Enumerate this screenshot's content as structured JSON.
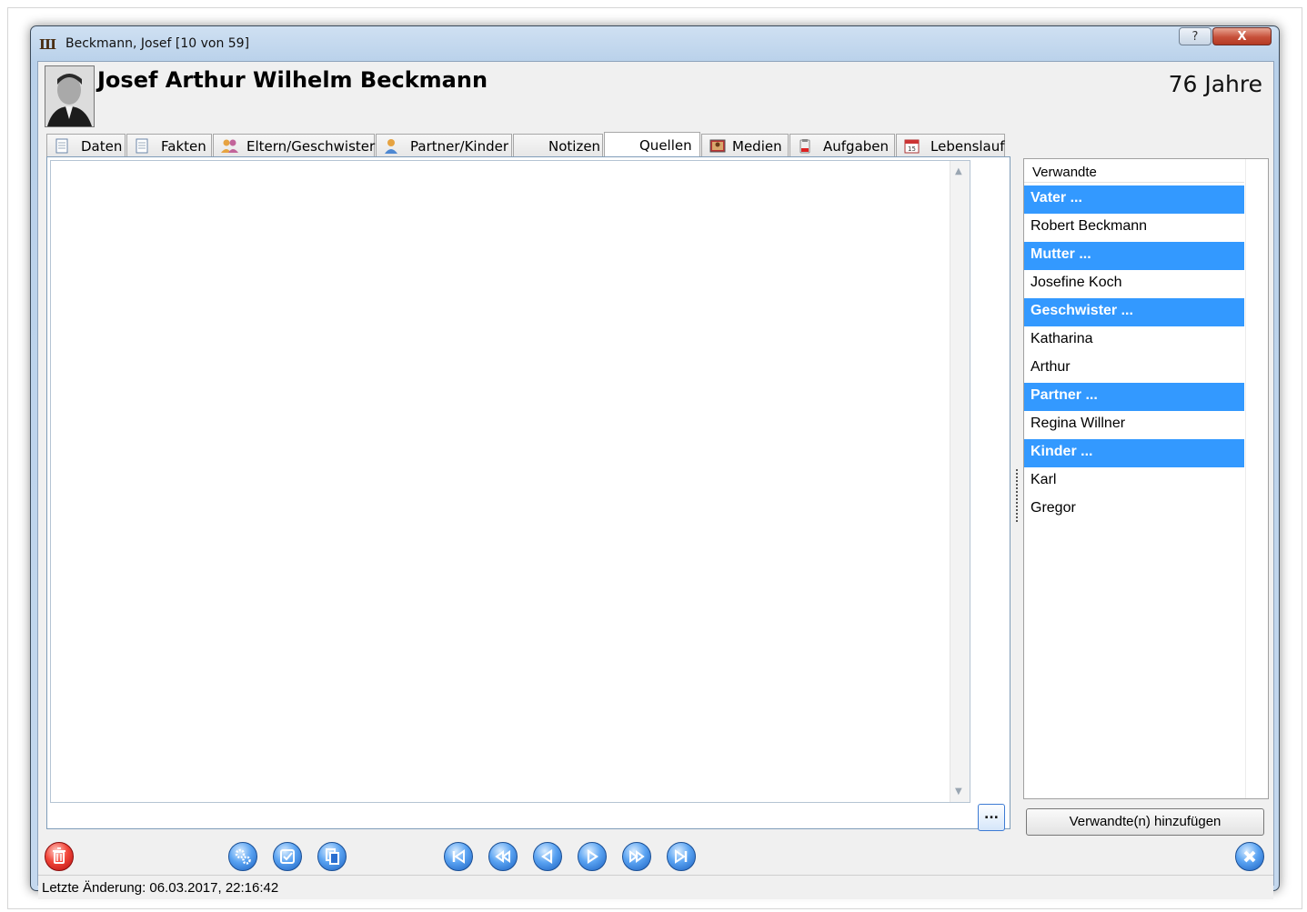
{
  "window": {
    "title": "Beckmann, Josef [10 von 59]",
    "help_label": "?",
    "close_label": "X"
  },
  "person": {
    "full_name": "Josef Arthur Wilhelm Beckmann",
    "age": "76 Jahre"
  },
  "tabs": [
    {
      "label": "Daten",
      "icon": "document-icon",
      "active": false
    },
    {
      "label": "Fakten",
      "icon": "document-icon",
      "active": false
    },
    {
      "label": "Eltern/Geschwister",
      "icon": "people-icon",
      "active": false
    },
    {
      "label": "Partner/Kinder",
      "icon": "person-icon",
      "active": false
    },
    {
      "label": "Notizen",
      "icon": "",
      "active": false
    },
    {
      "label": "Quellen",
      "icon": "",
      "active": true
    },
    {
      "label": "Medien",
      "icon": "picture-icon",
      "active": false
    },
    {
      "label": "Aufgaben",
      "icon": "clipboard-icon",
      "active": false
    },
    {
      "label": "Lebenslauf",
      "icon": "calendar-icon",
      "active": false
    }
  ],
  "calendar_icon_text": "15",
  "more_button_label": "...",
  "relatives": {
    "header": "Verwandte",
    "rows": [
      {
        "label": "Vater ...",
        "group": true
      },
      {
        "label": "Robert Beckmann",
        "group": false
      },
      {
        "label": "Mutter ...",
        "group": true
      },
      {
        "label": "Josefine Koch",
        "group": false
      },
      {
        "label": "Geschwister ...",
        "group": true
      },
      {
        "label": "Katharina",
        "group": false
      },
      {
        "label": "Arthur",
        "group": false
      },
      {
        "label": "Partner ...",
        "group": true
      },
      {
        "label": "Regina Willner",
        "group": false
      },
      {
        "label": "Kinder ...",
        "group": true
      },
      {
        "label": "Karl",
        "group": false
      },
      {
        "label": "Gregor",
        "group": false
      }
    ],
    "add_button": "Verwandte(n) hinzufügen"
  },
  "toolbar": {
    "buttons": [
      {
        "name": "delete-button",
        "icon": "trash-icon",
        "color": "red"
      },
      {
        "name": "settings-button",
        "icon": "gears-icon",
        "color": "blue"
      },
      {
        "name": "check-button",
        "icon": "checkbox-icon",
        "color": "blue"
      },
      {
        "name": "copy-button",
        "icon": "copy-icon",
        "color": "blue"
      },
      {
        "name": "first-record-button",
        "icon": "skip-first-icon",
        "color": "blue"
      },
      {
        "name": "rewind-button",
        "icon": "rewind-icon",
        "color": "blue"
      },
      {
        "name": "previous-button",
        "icon": "previous-icon",
        "color": "blue"
      },
      {
        "name": "next-button",
        "icon": "next-icon",
        "color": "blue"
      },
      {
        "name": "fast-forward-button",
        "icon": "fast-forward-icon",
        "color": "blue"
      },
      {
        "name": "last-record-button",
        "icon": "skip-last-icon",
        "color": "blue"
      },
      {
        "name": "close-form-button",
        "icon": "close-icon",
        "color": "blue"
      }
    ]
  },
  "status": {
    "last_change": "Letzte Änderung: 06.03.2017, 22:16:42"
  },
  "colors": {
    "selection": "#3399ff",
    "titlebar": "#c4d8ee",
    "close_button": "#c7503a"
  }
}
